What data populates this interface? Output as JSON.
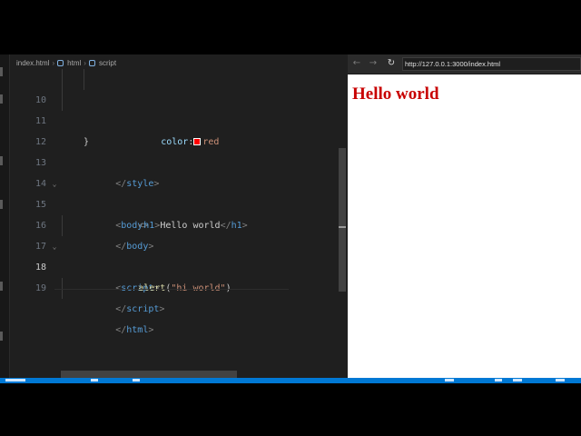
{
  "breadcrumb": {
    "file": "index.html",
    "node1": "html",
    "node2": "script",
    "file_icon": "html-file-icon",
    "node_icon": "cube-icon"
  },
  "editor": {
    "current_line": 18,
    "swatch_color": "#ff0000",
    "lines": [
      {
        "no": "10",
        "indent": "    ",
        "tokens": {
          "prop": "color",
          "colon": ":",
          "value": "red"
        }
      },
      {
        "no": "11",
        "text": "}"
      },
      {
        "no": "12",
        "open": "</",
        "tag": "style",
        "close": ">"
      },
      {
        "no": "13",
        "open": "<",
        "tag": "body",
        "close": ">",
        "fold": "⌄"
      },
      {
        "no": "14",
        "open": "<",
        "tag": "h1",
        "close": ">",
        "content": "Hello world",
        "open2": "</",
        "tag2": "h1",
        "close2": ">"
      },
      {
        "no": "15",
        "open": "</",
        "tag": "body",
        "close": ">"
      },
      {
        "no": "16",
        "open": "<",
        "tag": "script",
        "close": ">",
        "fold": "⌄"
      },
      {
        "no": "17",
        "fn": "alert",
        "paren_open": "(",
        "str": "\"hi world\"",
        "paren_close": ")"
      },
      {
        "no": "18",
        "open": "</",
        "tag": "script",
        "close": ">"
      },
      {
        "no": "19",
        "open": "</",
        "tag": "html",
        "close": ">"
      }
    ]
  },
  "browser": {
    "back_icon": "←",
    "forward_icon": "→",
    "reload_icon": "↻",
    "url": "http://127.0.0.1:3000/index.html",
    "heading": "Hello world",
    "heading_color": "#c80000"
  },
  "colors": {
    "editor_bg": "#1f1f1f",
    "status_bar": "#0078d4",
    "tag": "#569cd6",
    "string": "#ce9178",
    "function": "#dcdcaa",
    "property": "#9cdcfe"
  }
}
